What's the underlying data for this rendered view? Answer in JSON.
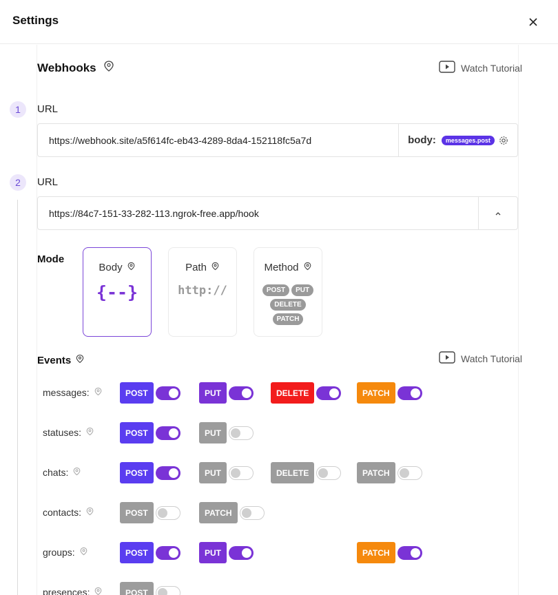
{
  "header": {
    "title": "Settings"
  },
  "webhooks": {
    "title": "Webhooks",
    "watch_tutorial": "Watch Tutorial",
    "urls": [
      {
        "num": "1",
        "label": "URL",
        "value": "https://webhook.site/a5f614fc-eb43-4289-8da4-152118fc5a7d",
        "body_label": "body:",
        "body_pill": "messages.post"
      },
      {
        "num": "2",
        "label": "URL",
        "value": "https://84c7-151-33-282-113.ngrok-free.app/hook"
      }
    ]
  },
  "mode": {
    "label": "Mode",
    "cards": [
      {
        "title": "Body",
        "symbol": "{--}"
      },
      {
        "title": "Path",
        "symbol": "http://"
      },
      {
        "title": "Method",
        "chips": [
          "POST",
          "PUT",
          "DELETE",
          "PATCH"
        ]
      }
    ]
  },
  "events": {
    "label": "Events",
    "watch_tutorial": "Watch Tutorial",
    "rows": [
      {
        "name": "messages:",
        "methods": [
          {
            "label": "POST",
            "on": true
          },
          {
            "label": "PUT",
            "on": true
          },
          {
            "label": "DELETE",
            "on": true
          },
          {
            "label": "PATCH",
            "on": true
          }
        ]
      },
      {
        "name": "statuses:",
        "methods": [
          {
            "label": "POST",
            "on": true
          },
          {
            "label": "PUT",
            "on": false
          }
        ]
      },
      {
        "name": "chats:",
        "methods": [
          {
            "label": "POST",
            "on": true
          },
          {
            "label": "PUT",
            "on": false
          },
          {
            "label": "DELETE",
            "on": false
          },
          {
            "label": "PATCH",
            "on": false
          }
        ]
      },
      {
        "name": "contacts:",
        "methods": [
          {
            "label": "POST",
            "on": false
          },
          {
            "label": "PATCH",
            "on": false
          }
        ]
      },
      {
        "name": "groups:",
        "methods": [
          {
            "label": "POST",
            "on": true
          },
          {
            "label": "PUT",
            "on": true
          },
          {
            "label": "PATCH",
            "on": true
          }
        ]
      },
      {
        "name": "presences:",
        "methods": [
          {
            "label": "POST",
            "on": false
          }
        ]
      }
    ]
  },
  "colors": {
    "post": "#5a3df0",
    "put": "#7a33d6",
    "delete": "#f21c1c",
    "patch": "#f5890d",
    "off": "#9c9c9c"
  }
}
